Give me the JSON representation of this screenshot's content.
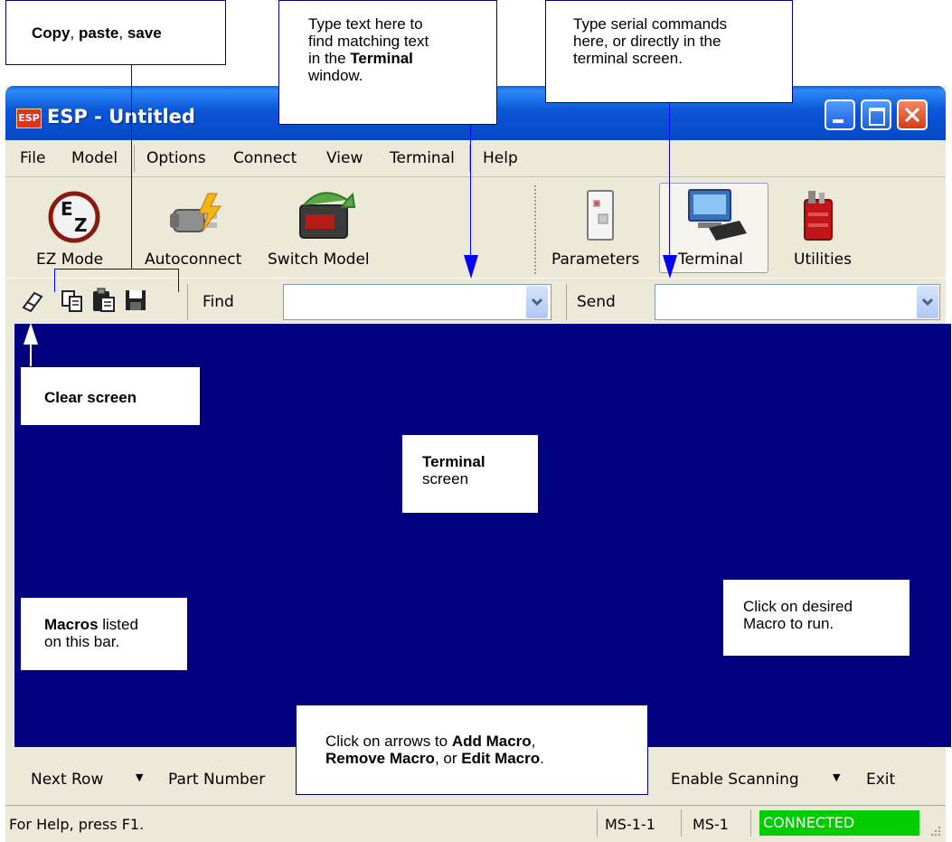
{
  "window": {
    "title": "ESP - Untitled",
    "app_icon_text": "ESP",
    "title_color": "#0a56d8"
  },
  "menu": [
    "File",
    "Model",
    "Options",
    "Connect",
    "View",
    "Terminal",
    "Help"
  ],
  "toolbar": {
    "left_buttons": [
      {
        "label": "EZ Mode",
        "icon": "ez-mode-icon"
      },
      {
        "label": "Autoconnect",
        "icon": "autoconnect-plug-icon"
      },
      {
        "label": "Switch Model",
        "icon": "switch-model-icon"
      }
    ],
    "right_buttons": [
      {
        "label": "Parameters",
        "icon": "parameters-switch-icon"
      },
      {
        "label": "Terminal",
        "icon": "terminal-computer-icon",
        "active": true
      },
      {
        "label": "Utilities",
        "icon": "utilities-toolbox-icon"
      }
    ]
  },
  "findbar": {
    "tools": [
      "eraser-icon",
      "copy-icon",
      "paste-icon",
      "save-icon"
    ],
    "find_label": "Find",
    "find_value": "",
    "send_label": "Send",
    "send_value": ""
  },
  "terminal": {
    "background": "#000080"
  },
  "macros": {
    "items": [
      "Next Row",
      "Part Number",
      "Enable Scanning",
      "Exit"
    ]
  },
  "status": {
    "help_text": "For Help, press F1.",
    "model_1": "MS-1-1",
    "model_2": "MS-1",
    "connection": "CONNECTED",
    "connection_color": "#00cc00"
  },
  "callouts": {
    "copy_paste_save": {
      "p1": "Copy",
      "p2": ", ",
      "p3": "paste",
      "p4": ", ",
      "p5": "save"
    },
    "find": {
      "l1": "Type text here to",
      "l2": "find matching text",
      "l3a": "in the ",
      "l3b": "Terminal",
      "l4": "window."
    },
    "send": {
      "l1": "Type serial commands",
      "l2": "here, or directly in the",
      "l3": "terminal screen."
    },
    "clear": {
      "text": "Clear screen"
    },
    "terminal_screen": {
      "l1": "Terminal",
      "l2": "screen"
    },
    "macros_listed": {
      "l1a": "Macros",
      "l1b": " listed",
      "l2": "on this bar."
    },
    "click_macro": {
      "l1": "Click on desired",
      "l2": "Macro to run."
    },
    "arrows": {
      "l1a": "Click on arrows to ",
      "l1b": "Add Macro",
      "l1c": ",",
      "l2a": "Remove Macro",
      "l2b": ", or ",
      "l2c": "Edit Macro",
      "l2d": "."
    }
  }
}
